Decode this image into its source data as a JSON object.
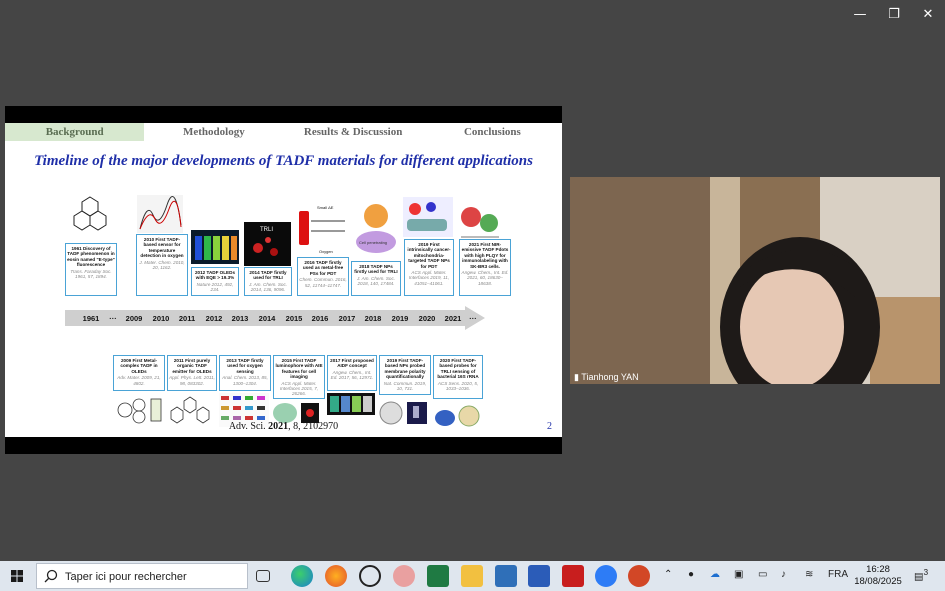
{
  "slide": {
    "tabs": [
      "Background",
      "Methodology",
      "Results & Discussion",
      "Conclusions"
    ],
    "title": "Timeline of the major developments of TADF materials for different applications",
    "years": [
      "1961",
      "···",
      "2009",
      "2010",
      "2011",
      "2012",
      "2013",
      "2014",
      "2015",
      "2016",
      "2017",
      "2018",
      "2019",
      "2020",
      "2021",
      "···"
    ],
    "top_boxes": [
      {
        "text": "1961 Discovery of TADF phenomenon in eosin named \"E-type\" fluorescence",
        "ref": "Trans. Faraday Soc. 1961, 57, 1894."
      },
      {
        "text": "2010 First TADF-based sensor for temperature detection in oxygen",
        "ref": "J. Mater. Chem. 2010, 20, 1162."
      },
      {
        "text": "2012 TADF OLEDs with EQE > 19.3%",
        "ref": "Nature 2012, 492, 234."
      },
      {
        "text": "2014 TADF firstly used for TRLI",
        "ref": "J. Am. Chem. Soc. 2014, 136, 9096."
      },
      {
        "text": "2016 TADF firstly used as metal-free PSs for PDT",
        "ref": "Chem. Commun. 2016, 52, 11744–11747."
      },
      {
        "text": "2018 TADF NPs firstly used for TRLI",
        "ref": "J. Am. Chem. Soc. 2018, 140, 17484."
      },
      {
        "text": "2019 First intrinsically cancer-mitochondria-targeted TADF NPs for PDT",
        "ref": "ACS Appl. Mater. Interfaces 2019, 11, 41051–41061."
      },
      {
        "text": "2021 First NIR-emissive TADF Pdots with high PLQY for immunolabeling with SK-BR3 cells.",
        "ref": "Angew. Chem., Int. Ed. 2021, 60, 18630–18638."
      }
    ],
    "bottom_boxes": [
      {
        "text": "2009 First Metal-complex TADF in OLEDs",
        "ref": "Adv. Mater. 2009, 21, 4802."
      },
      {
        "text": "2011 First purely organic TADF emitter for OLEDs",
        "ref": "Appl. Phys. Lett. 2011, 98, 083302."
      },
      {
        "text": "2013 TADF firstly used for oxygen sensing",
        "ref": "Anal. Chem. 2013, 85, 1300–1304."
      },
      {
        "text": "2015 First TADF luminophore with AIE features for cell imaging",
        "ref": "ACS Appl. Mater. Interfaces 2015, 7, 26266."
      },
      {
        "text": "2017 First proposed AIDF concept",
        "ref": "Angew. Chem., Int. Ed. 2017, 56, 12971."
      },
      {
        "text": "2019 First TADF-based NPs probed membrane polarity quantificationally",
        "ref": "Nat. Commun. 2019, 10, 731."
      },
      {
        "text": "2020 First TADF-based probes for TRLI sensing of bacterial 16S rRNA",
        "ref": "ACS Sens. 2020, 5, 1033–1036."
      }
    ],
    "citation_pre": "Adv. Sci. ",
    "citation_year": "2021",
    "citation_post": ", 8, 2102970",
    "page": "2",
    "trli_label": "TRLI",
    "cell_label": "Cell penetrating",
    "small_label": "Small ΔE",
    "oxygen_label": "Oxygen"
  },
  "video": {
    "name": "Tianhong YAN"
  },
  "window": {
    "minimize": "—",
    "restore": "❐",
    "close": "✕"
  },
  "taskbar": {
    "search_placeholder": "Taper ici pour rechercher",
    "lang": "FRA",
    "time": "16:28",
    "date": "18/08/2025",
    "notif_count": "3"
  },
  "colors": {
    "accent_blue": "#1f2fa8",
    "box_border": "#4aa3d6",
    "tab_active": "#d7e8cf",
    "arrow": "#cfcfcf"
  }
}
